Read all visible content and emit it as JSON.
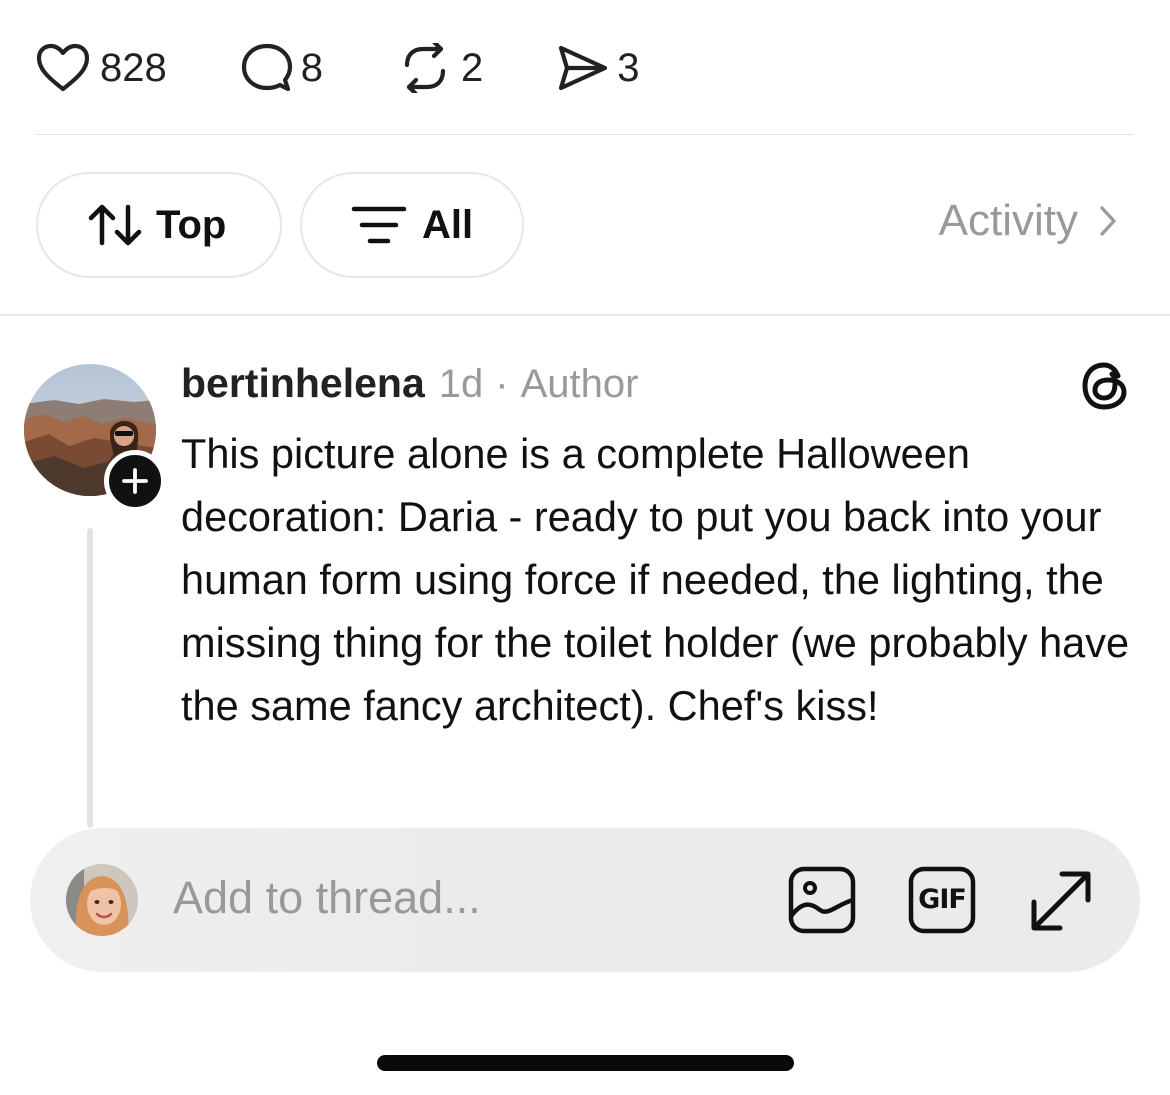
{
  "stats": {
    "likes": "828",
    "replies": "8",
    "reposts": "2",
    "shares": "3"
  },
  "filters": {
    "sort_label": "Top",
    "filter_label": "All",
    "activity_label": "Activity"
  },
  "post": {
    "username": "bertinhelena",
    "time": "1d",
    "separator": "·",
    "role": "Author",
    "text": "This picture alone is a complete Halloween decoration: Daria - ready to put you back into your human form using force if needed, the lighting, the missing thing for the toilet holder (we probably have the same fancy architect). Chef's kiss!"
  },
  "composer": {
    "placeholder": "Add to thread...",
    "gif_label": "GIF"
  },
  "icons": {
    "like": "heart-icon",
    "reply": "comment-bubble-icon",
    "repost": "repost-icon",
    "share": "send-icon",
    "sort": "sort-arrows-icon",
    "filter": "filter-lines-icon",
    "activity": "chevron-right-icon",
    "threads": "threads-logo-icon",
    "follow": "plus-icon",
    "image": "image-icon",
    "gif": "gif-icon",
    "expand": "expand-icon"
  },
  "colors": {
    "text": "#111111",
    "muted": "#999999",
    "divider": "#e3e3e3",
    "composer_bg": "#ebebeb"
  }
}
